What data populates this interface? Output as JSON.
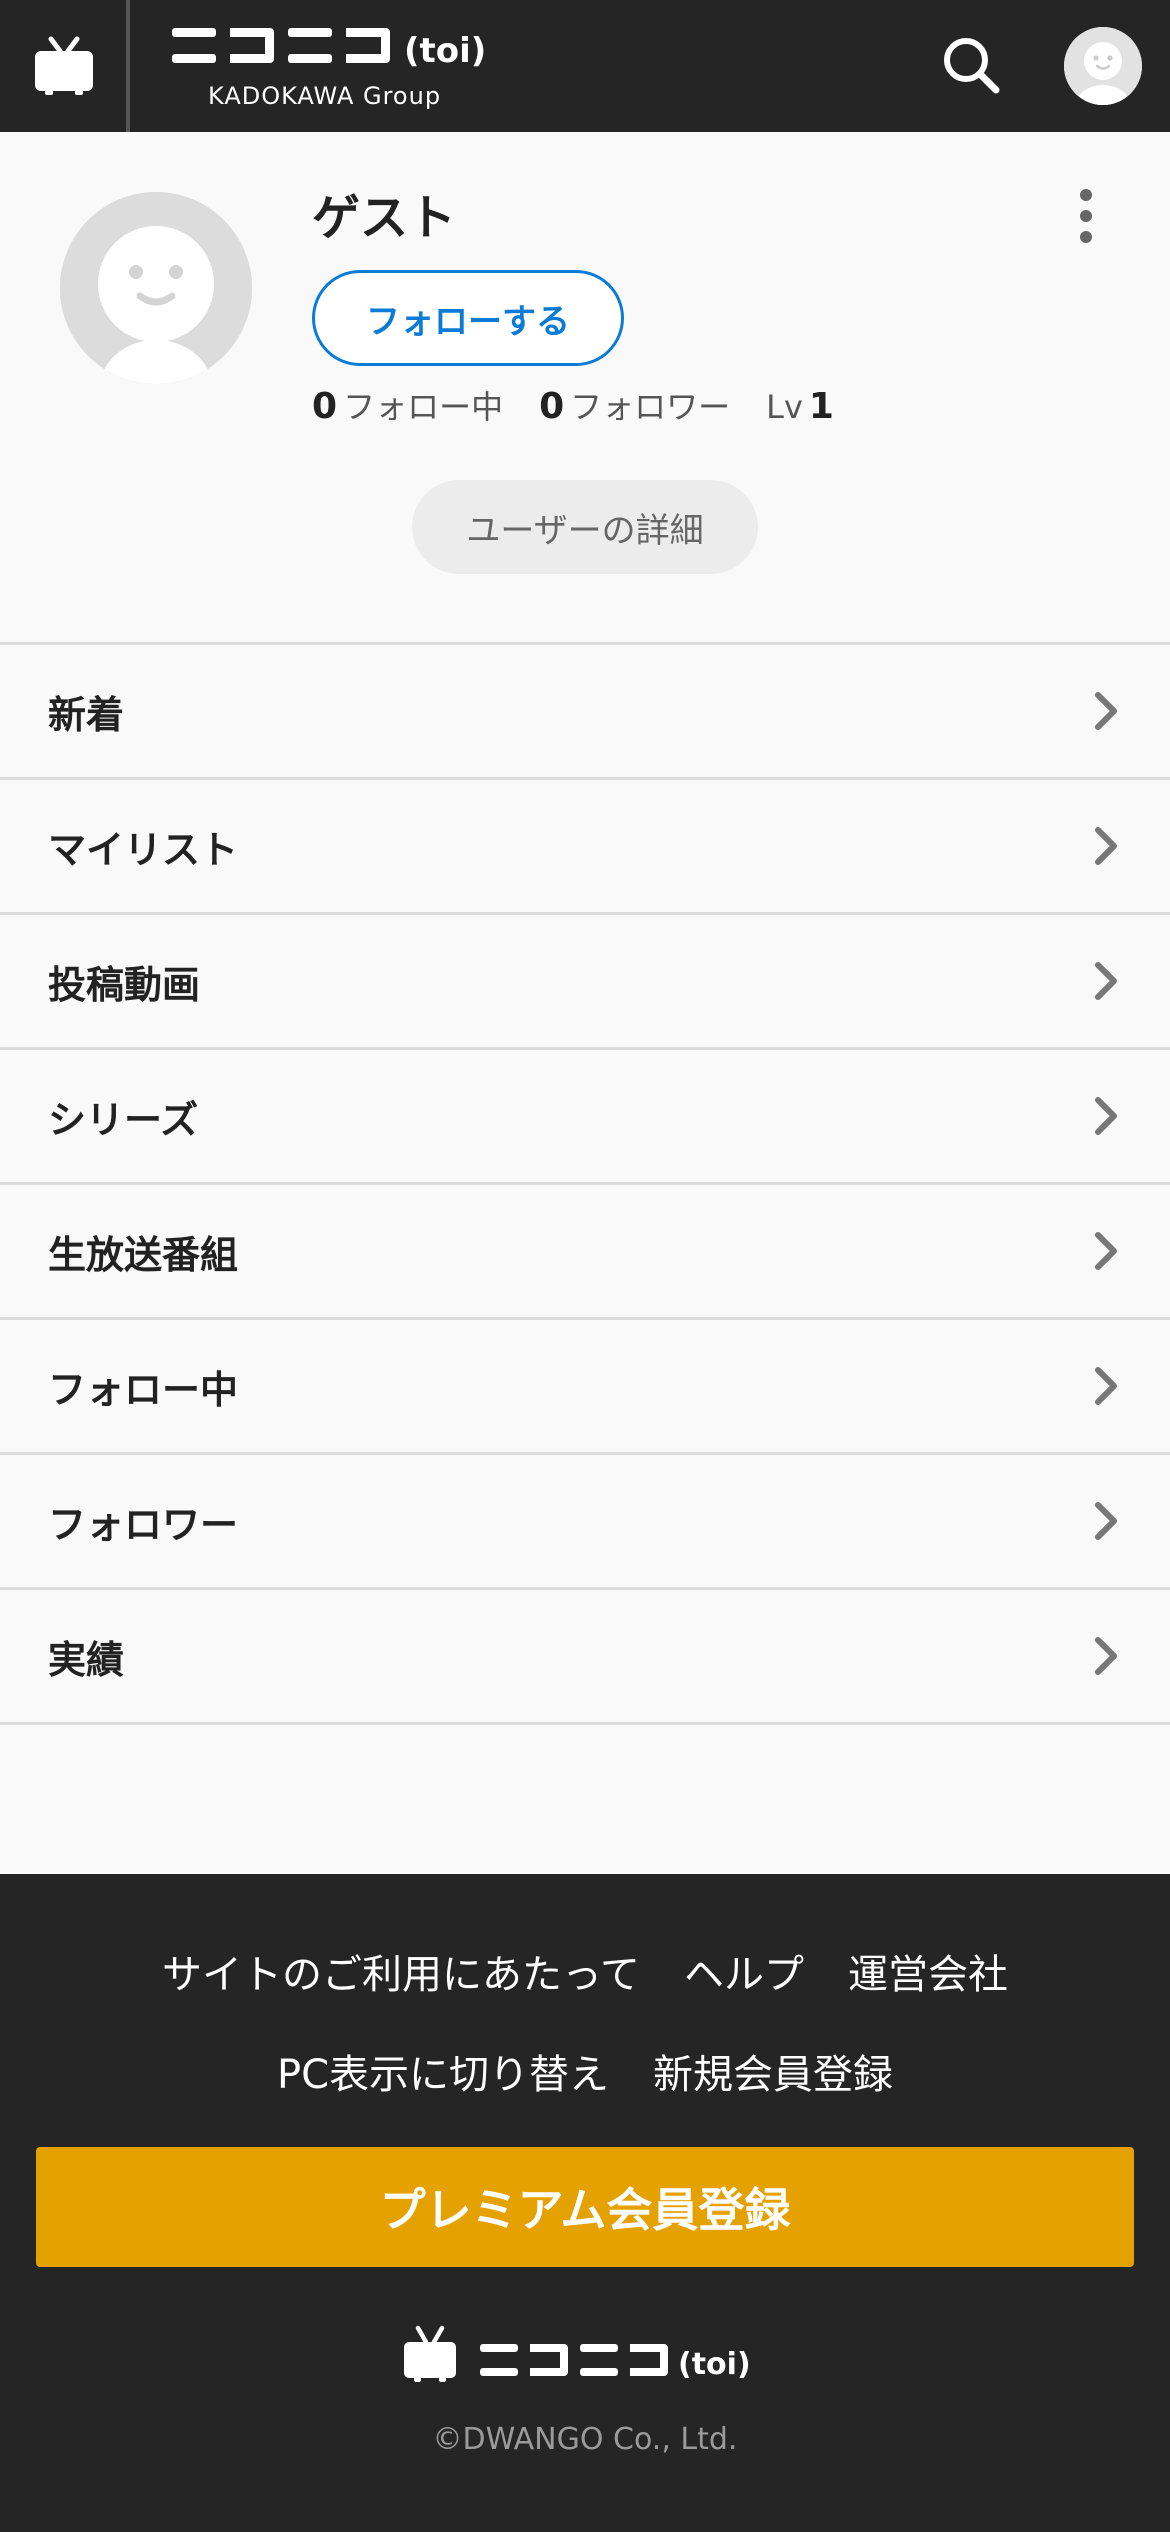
{
  "header": {
    "logo_subtitle": "KADOKAWA Group"
  },
  "profile": {
    "name": "ゲスト",
    "follow_label": "フォローする",
    "following_count": "0",
    "following_label": "フォロー中",
    "follower_count": "0",
    "follower_label": "フォロワー",
    "level_label": "Lv",
    "level_value": "1",
    "detail_label": "ユーザーの詳細"
  },
  "menu": {
    "items": [
      {
        "label": "新着"
      },
      {
        "label": "マイリスト"
      },
      {
        "label": "投稿動画"
      },
      {
        "label": "シリーズ"
      },
      {
        "label": "生放送番組"
      },
      {
        "label": "フォロー中"
      },
      {
        "label": "フォロワー"
      },
      {
        "label": "実績"
      }
    ]
  },
  "footer": {
    "links_row1": [
      "サイトのご利用にあたって",
      "ヘルプ",
      "運営会社"
    ],
    "links_row2": [
      "PC表示に切り替え",
      "新規会員登録"
    ],
    "premium_label": "プレミアム会員登録",
    "copyright": "©DWANGO Co., Ltd."
  },
  "colors": {
    "header_bg": "#252525",
    "accent_blue": "#0a7bd6",
    "premium_gold": "#e5a100"
  },
  "icons": [
    "tv-icon",
    "search-icon",
    "avatar-icon",
    "kebab-icon",
    "chevron-right-icon"
  ]
}
